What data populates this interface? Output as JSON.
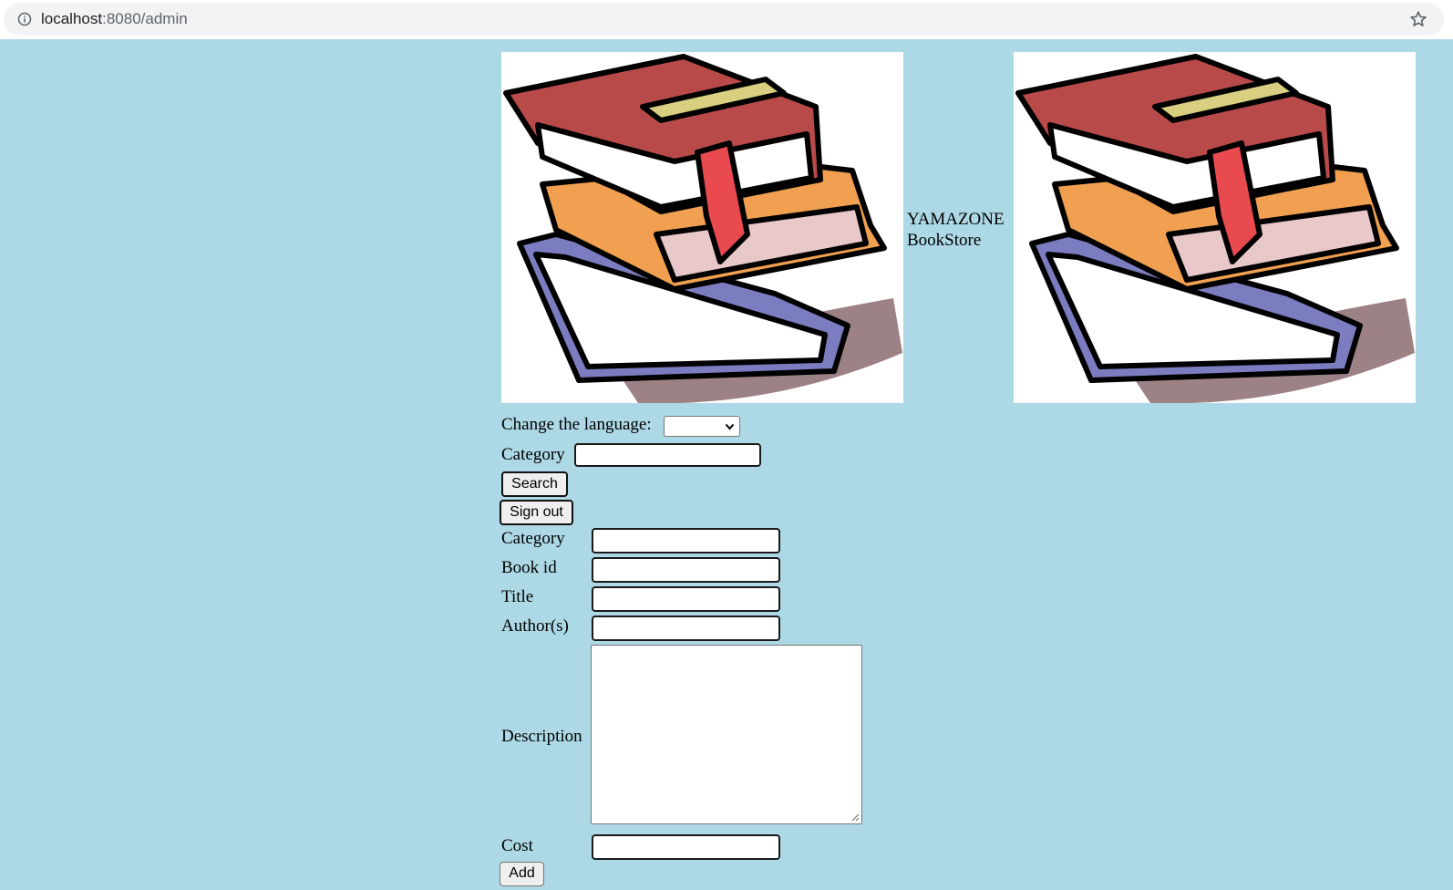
{
  "browser": {
    "url_host": "localhost",
    "url_path": ":8080/admin"
  },
  "header": {
    "store_name_line1": "YAMAZONE",
    "store_name_line2": "BookStore",
    "logo_image": "stack-of-books-image"
  },
  "language": {
    "label": "Change the language:",
    "selected": ""
  },
  "search": {
    "category_label": "Category",
    "category_value": "",
    "search_button": "Search"
  },
  "session": {
    "sign_out_button": "Sign out"
  },
  "add_book_form": {
    "category_label": "Category",
    "book_id_label": "Book id",
    "title_label": "Title",
    "authors_label": "Author(s)",
    "description_label": "Description",
    "cost_label": "Cost",
    "add_button": "Add",
    "values": {
      "category": "",
      "book_id": "",
      "title": "",
      "authors": "",
      "description": "",
      "cost": ""
    }
  },
  "colors": {
    "page_background": "#add8e6",
    "address_bar": "#f1f3f4"
  }
}
